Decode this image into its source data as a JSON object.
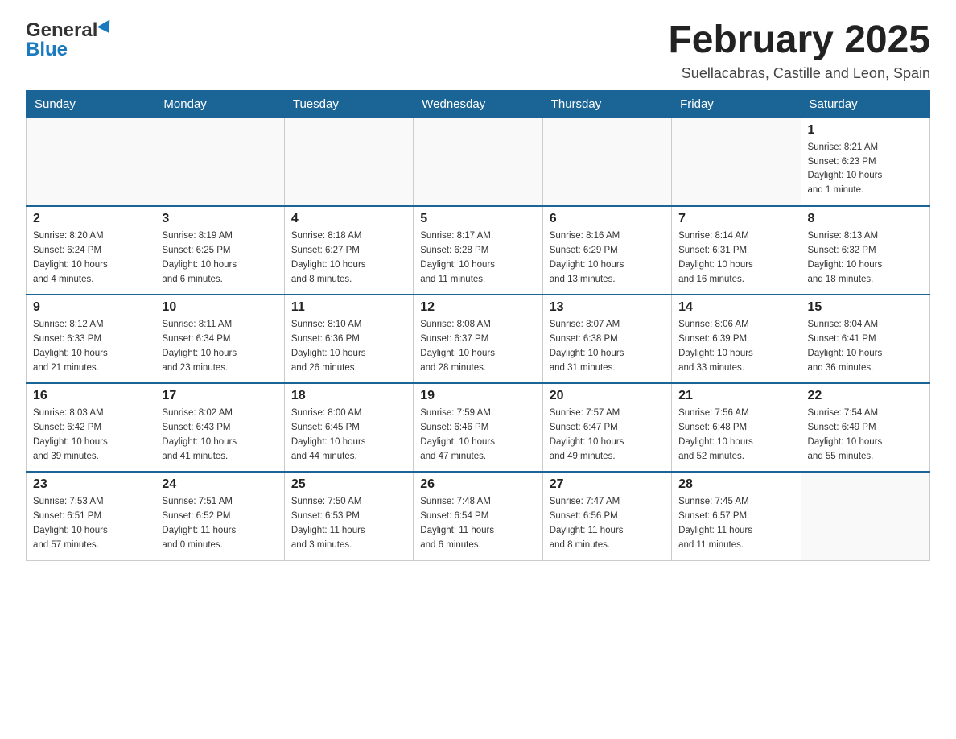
{
  "header": {
    "logo_general": "General",
    "logo_blue": "Blue",
    "month_title": "February 2025",
    "location": "Suellacabras, Castille and Leon, Spain"
  },
  "days_of_week": [
    "Sunday",
    "Monday",
    "Tuesday",
    "Wednesday",
    "Thursday",
    "Friday",
    "Saturday"
  ],
  "weeks": [
    [
      {
        "day": "",
        "info": ""
      },
      {
        "day": "",
        "info": ""
      },
      {
        "day": "",
        "info": ""
      },
      {
        "day": "",
        "info": ""
      },
      {
        "day": "",
        "info": ""
      },
      {
        "day": "",
        "info": ""
      },
      {
        "day": "1",
        "info": "Sunrise: 8:21 AM\nSunset: 6:23 PM\nDaylight: 10 hours\nand 1 minute."
      }
    ],
    [
      {
        "day": "2",
        "info": "Sunrise: 8:20 AM\nSunset: 6:24 PM\nDaylight: 10 hours\nand 4 minutes."
      },
      {
        "day": "3",
        "info": "Sunrise: 8:19 AM\nSunset: 6:25 PM\nDaylight: 10 hours\nand 6 minutes."
      },
      {
        "day": "4",
        "info": "Sunrise: 8:18 AM\nSunset: 6:27 PM\nDaylight: 10 hours\nand 8 minutes."
      },
      {
        "day": "5",
        "info": "Sunrise: 8:17 AM\nSunset: 6:28 PM\nDaylight: 10 hours\nand 11 minutes."
      },
      {
        "day": "6",
        "info": "Sunrise: 8:16 AM\nSunset: 6:29 PM\nDaylight: 10 hours\nand 13 minutes."
      },
      {
        "day": "7",
        "info": "Sunrise: 8:14 AM\nSunset: 6:31 PM\nDaylight: 10 hours\nand 16 minutes."
      },
      {
        "day": "8",
        "info": "Sunrise: 8:13 AM\nSunset: 6:32 PM\nDaylight: 10 hours\nand 18 minutes."
      }
    ],
    [
      {
        "day": "9",
        "info": "Sunrise: 8:12 AM\nSunset: 6:33 PM\nDaylight: 10 hours\nand 21 minutes."
      },
      {
        "day": "10",
        "info": "Sunrise: 8:11 AM\nSunset: 6:34 PM\nDaylight: 10 hours\nand 23 minutes."
      },
      {
        "day": "11",
        "info": "Sunrise: 8:10 AM\nSunset: 6:36 PM\nDaylight: 10 hours\nand 26 minutes."
      },
      {
        "day": "12",
        "info": "Sunrise: 8:08 AM\nSunset: 6:37 PM\nDaylight: 10 hours\nand 28 minutes."
      },
      {
        "day": "13",
        "info": "Sunrise: 8:07 AM\nSunset: 6:38 PM\nDaylight: 10 hours\nand 31 minutes."
      },
      {
        "day": "14",
        "info": "Sunrise: 8:06 AM\nSunset: 6:39 PM\nDaylight: 10 hours\nand 33 minutes."
      },
      {
        "day": "15",
        "info": "Sunrise: 8:04 AM\nSunset: 6:41 PM\nDaylight: 10 hours\nand 36 minutes."
      }
    ],
    [
      {
        "day": "16",
        "info": "Sunrise: 8:03 AM\nSunset: 6:42 PM\nDaylight: 10 hours\nand 39 minutes."
      },
      {
        "day": "17",
        "info": "Sunrise: 8:02 AM\nSunset: 6:43 PM\nDaylight: 10 hours\nand 41 minutes."
      },
      {
        "day": "18",
        "info": "Sunrise: 8:00 AM\nSunset: 6:45 PM\nDaylight: 10 hours\nand 44 minutes."
      },
      {
        "day": "19",
        "info": "Sunrise: 7:59 AM\nSunset: 6:46 PM\nDaylight: 10 hours\nand 47 minutes."
      },
      {
        "day": "20",
        "info": "Sunrise: 7:57 AM\nSunset: 6:47 PM\nDaylight: 10 hours\nand 49 minutes."
      },
      {
        "day": "21",
        "info": "Sunrise: 7:56 AM\nSunset: 6:48 PM\nDaylight: 10 hours\nand 52 minutes."
      },
      {
        "day": "22",
        "info": "Sunrise: 7:54 AM\nSunset: 6:49 PM\nDaylight: 10 hours\nand 55 minutes."
      }
    ],
    [
      {
        "day": "23",
        "info": "Sunrise: 7:53 AM\nSunset: 6:51 PM\nDaylight: 10 hours\nand 57 minutes."
      },
      {
        "day": "24",
        "info": "Sunrise: 7:51 AM\nSunset: 6:52 PM\nDaylight: 11 hours\nand 0 minutes."
      },
      {
        "day": "25",
        "info": "Sunrise: 7:50 AM\nSunset: 6:53 PM\nDaylight: 11 hours\nand 3 minutes."
      },
      {
        "day": "26",
        "info": "Sunrise: 7:48 AM\nSunset: 6:54 PM\nDaylight: 11 hours\nand 6 minutes."
      },
      {
        "day": "27",
        "info": "Sunrise: 7:47 AM\nSunset: 6:56 PM\nDaylight: 11 hours\nand 8 minutes."
      },
      {
        "day": "28",
        "info": "Sunrise: 7:45 AM\nSunset: 6:57 PM\nDaylight: 11 hours\nand 11 minutes."
      },
      {
        "day": "",
        "info": ""
      }
    ]
  ]
}
